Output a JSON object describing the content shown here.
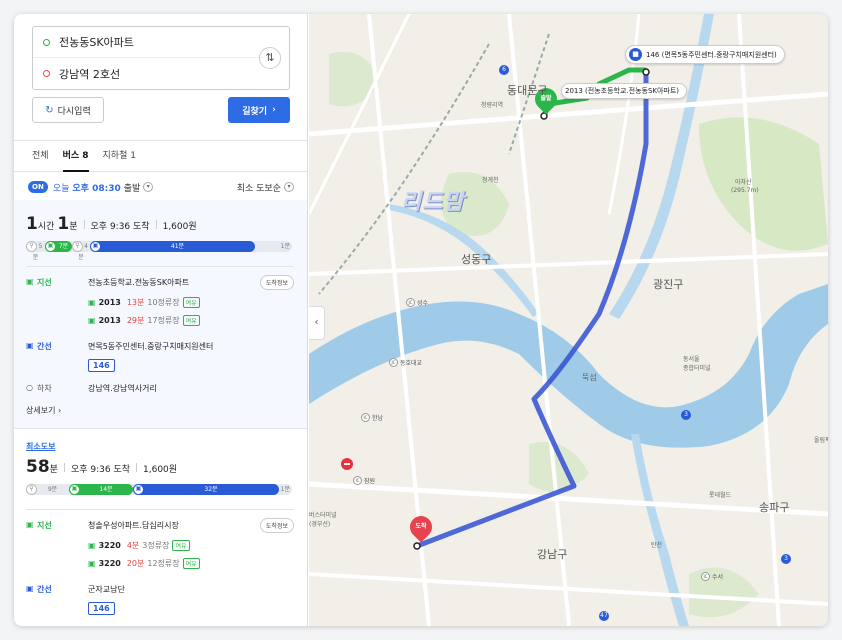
{
  "search": {
    "origin": "전농동SK아파트",
    "destination": "강남역 2호선",
    "swap_icon": "swap-vertical-icon",
    "reset_label": "다시입력",
    "find_label": "길찾기"
  },
  "tabs": [
    {
      "label": "전체"
    },
    {
      "label": "버스 8"
    },
    {
      "label": "지하철 1"
    }
  ],
  "filter": {
    "on_badge": "ON",
    "day": "오늘",
    "time": "오후 08:30",
    "depart": "출발",
    "sort": "최소 도보순"
  },
  "route1": {
    "hours": "1",
    "hours_unit": "시간",
    "minutes": "1",
    "minutes_unit": "분",
    "arrival": "오후 9:36 도착",
    "fare": "1,600원",
    "bar": [
      {
        "label": "5분",
        "type": "walk"
      },
      {
        "label": "7분",
        "type": "green"
      },
      {
        "label": "4분",
        "type": "walk"
      },
      {
        "label": "41분",
        "type": "blue"
      },
      {
        "label": "1분",
        "type": "walk"
      }
    ],
    "bar_fractions": [
      0.07,
      0.1,
      0.06,
      0.62,
      0.02
    ],
    "step1": {
      "kind": "지선",
      "stop": "전농초등학교.전농동SK아파트",
      "info_btn": "도착정보"
    },
    "buses": [
      {
        "no": "2013",
        "min": "13분",
        "stops": "10정류장",
        "tag": "여유"
      },
      {
        "no": "2013",
        "min": "29분",
        "stops": "17정류장",
        "tag": "여유"
      }
    ],
    "step2": {
      "kind": "간선",
      "stop": "면목5동주민센터.중랑구치매지원센터",
      "route": "146"
    },
    "step3": {
      "kind": "하차",
      "stop": "강남역.강남역사거리"
    },
    "detail": "상세보기"
  },
  "route2": {
    "badge": "최소도보",
    "minutes": "58",
    "minutes_unit": "분",
    "arrival": "오후 9:36 도착",
    "fare": "1,600원",
    "bar": [
      {
        "label": "9분",
        "type": "walk"
      },
      {
        "label": "14분",
        "type": "green"
      },
      {
        "label": "32분",
        "type": "blue"
      },
      {
        "label": "1분",
        "type": "walk"
      }
    ],
    "bar_fractions": [
      0.16,
      0.24,
      0.55,
      0.02
    ],
    "step1": {
      "kind": "지선",
      "stop": "청솔우성아파트.답십리시장",
      "info_btn": "도착정보"
    },
    "buses": [
      {
        "no": "3220",
        "min": "4분",
        "stops": "3정류장",
        "tag": "여유"
      },
      {
        "no": "3220",
        "min": "20분",
        "stops": "12정류장",
        "tag": "여유"
      }
    ],
    "step2": {
      "kind": "간선",
      "stop": "군자교남단",
      "route": "146"
    }
  },
  "map": {
    "callout_top": "146 (면목5동주민센터.중랑구치매지원센터)",
    "callout_green": "2013 (전농초등학교.전농동SK아파트)",
    "start_pin": "출발",
    "end_pin": "도착",
    "watermark": "리드맘",
    "labels": {
      "dongdaemun": "동대문구",
      "cheongnyangni": "청량리역",
      "seongdong": "성동구",
      "gwangjin": "광진구",
      "achasan": "아차산",
      "achasan_h": "(295.7m)",
      "gangnam": "강남구",
      "songpa": "송파구",
      "lotteworld": "롯데월드",
      "olympic": "올림픽",
      "ttukseom": "뚝섬",
      "seoul_forest": "동서울\n종합터미널",
      "terminal": "버스터미널\n(경부선)",
      "cheonho": "청계천",
      "seongsu": "성수",
      "dongho": "동호대교",
      "hannam": "한남",
      "jamwon": "잠원",
      "suseo": "수서",
      "tancheon": "탄천"
    },
    "shields": [
      "6",
      "3",
      "3",
      "47"
    ]
  }
}
